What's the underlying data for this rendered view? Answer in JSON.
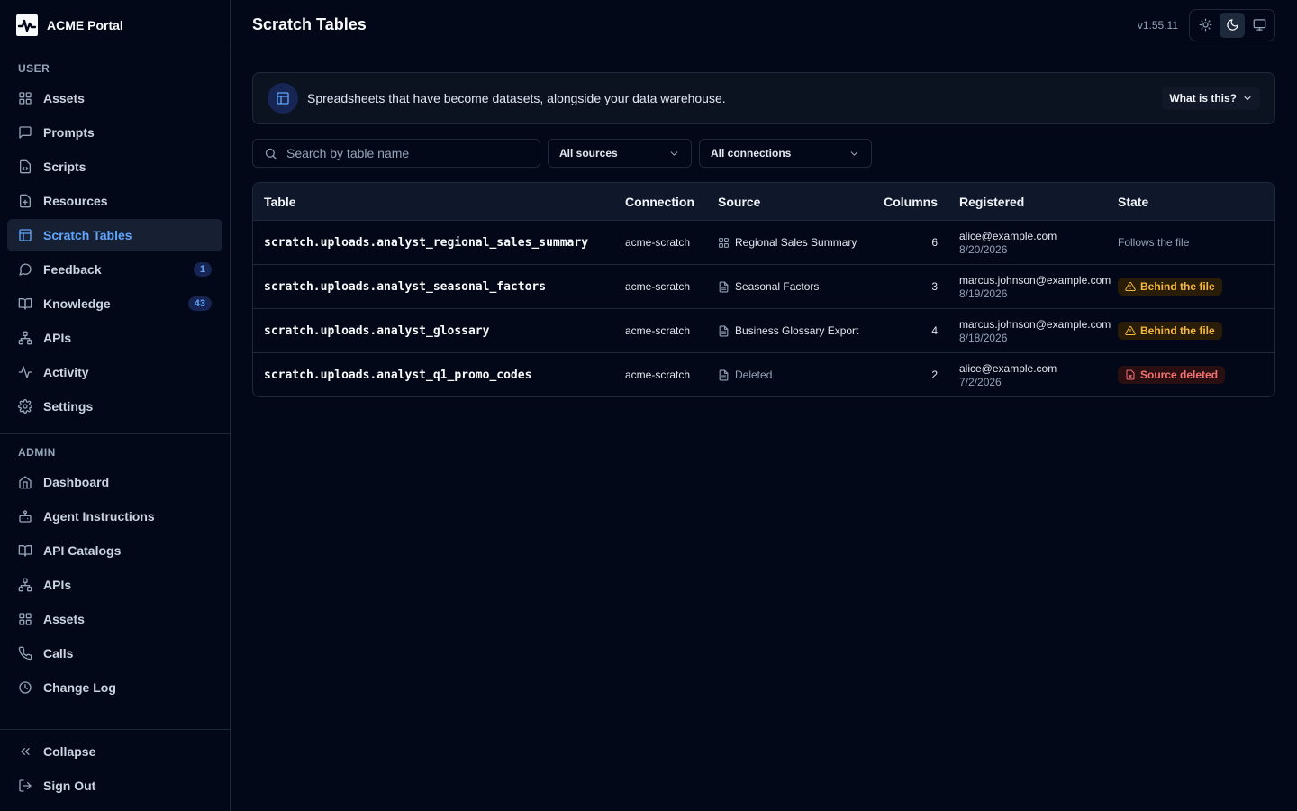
{
  "brand": {
    "name": "ACME Portal"
  },
  "sidebar": {
    "user_label": "USER",
    "user_items": [
      {
        "label": "Assets",
        "icon": "grid-icon"
      },
      {
        "label": "Prompts",
        "icon": "message-square-icon"
      },
      {
        "label": "Scripts",
        "icon": "code-file-icon"
      },
      {
        "label": "Resources",
        "icon": "file-plus-icon"
      },
      {
        "label": "Scratch Tables",
        "icon": "table-icon",
        "active": true
      },
      {
        "label": "Feedback",
        "icon": "message-circle-icon",
        "badge": "1"
      },
      {
        "label": "Knowledge",
        "icon": "book-open-icon",
        "badge": "43"
      },
      {
        "label": "APIs",
        "icon": "network-icon"
      },
      {
        "label": "Activity",
        "icon": "activity-icon"
      },
      {
        "label": "Settings",
        "icon": "gear-icon"
      }
    ],
    "admin_label": "ADMIN",
    "admin_items": [
      {
        "label": "Dashboard",
        "icon": "home-icon"
      },
      {
        "label": "Agent Instructions",
        "icon": "bot-icon"
      },
      {
        "label": "API Catalogs",
        "icon": "book-open-icon"
      },
      {
        "label": "APIs",
        "icon": "network-icon"
      },
      {
        "label": "Assets",
        "icon": "grid-icon"
      },
      {
        "label": "Calls",
        "icon": "phone-icon"
      },
      {
        "label": "Change Log",
        "icon": "clock-icon"
      }
    ],
    "footer": {
      "collapse": "Collapse",
      "sign_out": "Sign Out"
    }
  },
  "header": {
    "title": "Scratch Tables",
    "version": "v1.55.11"
  },
  "banner": {
    "text": "Spreadsheets that have become datasets, alongside your data warehouse.",
    "button": "What is this?"
  },
  "filters": {
    "search_placeholder": "Search by table name",
    "sources": "All sources",
    "connections": "All connections"
  },
  "table": {
    "headers": {
      "table": "Table",
      "connection": "Connection",
      "source": "Source",
      "columns": "Columns",
      "registered": "Registered",
      "state": "State"
    },
    "rows": [
      {
        "name": "scratch.uploads.analyst_regional_sales_summary",
        "connection": "acme-scratch",
        "source": "Regional Sales Summary",
        "source_icon": "grid-icon",
        "columns": "6",
        "email": "alice@example.com",
        "date": "8/20/2026",
        "state": "Follows the file",
        "state_kind": "plain"
      },
      {
        "name": "scratch.uploads.analyst_seasonal_factors",
        "connection": "acme-scratch",
        "source": "Seasonal Factors",
        "source_icon": "spreadsheet-file-icon",
        "columns": "3",
        "email": "marcus.johnson@example.com",
        "date": "8/19/2026",
        "state": "Behind the file",
        "state_kind": "warn"
      },
      {
        "name": "scratch.uploads.analyst_glossary",
        "connection": "acme-scratch",
        "source": "Business Glossary Export",
        "source_icon": "spreadsheet-file-icon",
        "columns": "4",
        "email": "marcus.johnson@example.com",
        "date": "8/18/2026",
        "state": "Behind the file",
        "state_kind": "warn"
      },
      {
        "name": "scratch.uploads.analyst_q1_promo_codes",
        "connection": "acme-scratch",
        "source": "Deleted",
        "source_icon": "spreadsheet-file-icon",
        "source_deleted": true,
        "columns": "2",
        "email": "alice@example.com",
        "date": "7/2/2026",
        "state": "Source deleted",
        "state_kind": "danger"
      }
    ]
  },
  "colors": {
    "background": "#020817",
    "accent": "#60a5fa",
    "warning": "#f5b83d",
    "danger": "#f87171"
  }
}
